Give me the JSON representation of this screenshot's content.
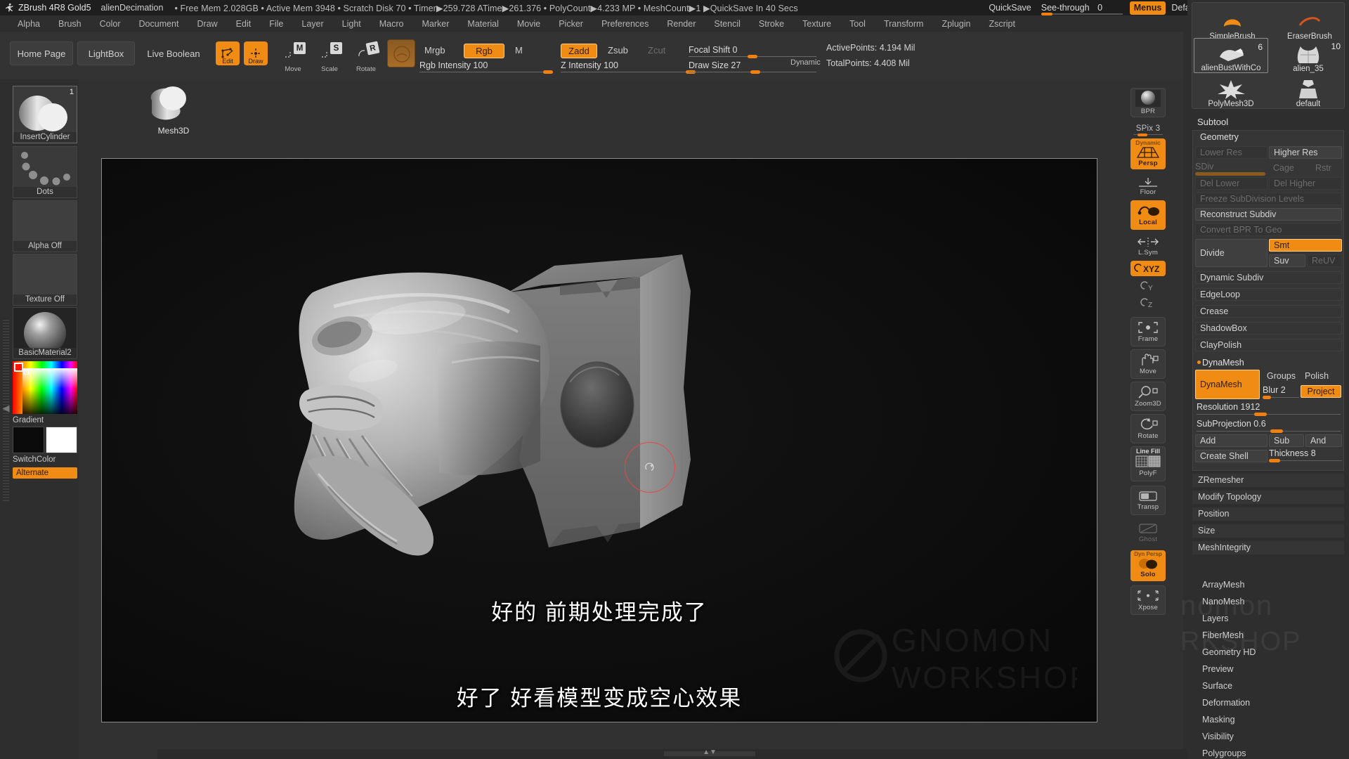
{
  "titlebar": {
    "app": "ZBrush 4R8 Gold5",
    "document": "alienDecimation",
    "stats": "• Free Mem 2.028GB • Active Mem 3948 • Scratch Disk 70 • Timer▶259.728 ATime▶261.376 • PolyCount▶4.233 MP • MeshCount▶1 ▶QuickSave In 40 Secs",
    "quicksave": "QuickSave",
    "seethrough_label": "See-through",
    "seethrough_value": "0",
    "menus": "Menus",
    "default_zscript": "DefaultZScript",
    "dots": "||||"
  },
  "menubar": {
    "items": [
      "Alpha",
      "Brush",
      "Color",
      "Document",
      "Draw",
      "Edit",
      "File",
      "Layer",
      "Light",
      "Macro",
      "Marker",
      "Material",
      "Movie",
      "Picker",
      "Preferences",
      "Render",
      "Stencil",
      "Stroke",
      "Texture",
      "Tool",
      "Transform",
      "Zplugin",
      "Zscript"
    ]
  },
  "shelf": {
    "home_page": "Home Page",
    "lightbox": "LightBox",
    "live_boolean": "Live Boolean",
    "tools": [
      {
        "label": "Edit",
        "state": "on",
        "glyph": ""
      },
      {
        "label": "Draw",
        "state": "on",
        "glyph": ""
      },
      {
        "label": "Move",
        "state": "off",
        "glyph": "M"
      },
      {
        "label": "Scale",
        "state": "off",
        "glyph": "S"
      },
      {
        "label": "Rotate",
        "state": "off",
        "glyph": "R"
      }
    ],
    "color_modes": [
      {
        "label": "Mrgb",
        "state": "off"
      },
      {
        "label": "Rgb",
        "state": "on"
      },
      {
        "label": "M",
        "state": "off"
      }
    ],
    "z_modes": [
      {
        "label": "Zadd",
        "state": "on"
      },
      {
        "label": "Zsub",
        "state": "off"
      },
      {
        "label": "Zcut",
        "state": "dim"
      }
    ],
    "rgb_intensity": {
      "label": "Rgb Intensity 100",
      "fill_pct": 97
    },
    "z_intensity": {
      "label": "Z Intensity 100",
      "fill_pct": 97
    },
    "focal_shift": {
      "label": "Focal Shift 0",
      "fill_pct": 50
    },
    "draw_size": {
      "label": "Draw Size 27",
      "fill_pct": 52
    },
    "dynamic": "Dynamic",
    "active_points": "ActivePoints: 4.194 Mil",
    "total_points": "TotalPoints: 4.408 Mil"
  },
  "left_tray": {
    "brush": {
      "name": "InsertCylinder",
      "badge": "1"
    },
    "mesh3d": {
      "name": "Mesh3D"
    },
    "stroke": {
      "name": "Dots"
    },
    "alpha": {
      "name": "Alpha Off"
    },
    "texture": {
      "name": "Texture Off"
    },
    "material": {
      "name": "BasicMaterial2"
    },
    "gradient": {
      "name": "Gradient"
    },
    "switch_color": {
      "name": "SwitchColor"
    },
    "alternate": {
      "name": "Alternate"
    }
  },
  "canvas": {
    "subtitle_line1": "好的 前期处理完成了",
    "subtitle_line2": "好了 好看模型变成空心效果"
  },
  "right_toolbar": [
    {
      "label": "BPR",
      "state": "off",
      "icon": "sphere-render-icon"
    },
    {
      "label": "SPix 3",
      "state": "slider",
      "icon": "spix-slider"
    },
    {
      "label": "Persp",
      "state": "on",
      "icon": "perspective-icon",
      "sublabel": "Dynamic"
    },
    {
      "label": "Floor",
      "state": "plain",
      "icon": "floor-grid-icon"
    },
    {
      "label": "Local",
      "state": "on",
      "icon": "local-transform-icon"
    },
    {
      "label": "L.Sym",
      "state": "plain",
      "icon": "local-symmetry-icon"
    },
    {
      "label": "XYZ",
      "state": "on",
      "icon": "xyz-axis-icon"
    },
    {
      "label": "Y",
      "state": "plain",
      "icon": "y-rotate-icon"
    },
    {
      "label": "Z",
      "state": "plain",
      "icon": "z-rotate-icon"
    },
    {
      "label": "Frame",
      "state": "off",
      "icon": "frame-icon"
    },
    {
      "label": "Move",
      "state": "off",
      "icon": "hand-move-icon"
    },
    {
      "label": "Zoom3D",
      "state": "off",
      "icon": "magnifier-icon"
    },
    {
      "label": "Rotate",
      "state": "off",
      "icon": "rotate-icon"
    },
    {
      "label": "PolyF",
      "state": "off",
      "icon": "polyframe-icon",
      "sublabel": "Line Fill"
    },
    {
      "label": "Transp",
      "state": "off",
      "icon": "transparency-icon"
    },
    {
      "label": "Ghost",
      "state": "dim",
      "icon": "ghost-icon"
    },
    {
      "label": "Solo",
      "state": "on",
      "icon": "solo-icon",
      "sublabel": "Dyn Persp"
    },
    {
      "label": "Xpose",
      "state": "off",
      "icon": "xpose-icon"
    }
  ],
  "right_panel": {
    "brushes": [
      {
        "name": "SimpleBrush",
        "badge": ""
      },
      {
        "name": "EraserBrush",
        "badge": ""
      },
      {
        "name": "alienBustWithCo",
        "badge": "6",
        "selected": true
      },
      {
        "name": "alien_35",
        "badge": "10"
      },
      {
        "name": "PolyMesh3D",
        "badge": ""
      },
      {
        "name": "default",
        "badge": ""
      }
    ],
    "subtool_title": "Subtool",
    "geometry_title": "Geometry",
    "geometry": {
      "lower_res": "Lower Res",
      "higher_res": "Higher Res",
      "sdiv": "SDiv",
      "cage": "Cage",
      "rstr": "Rstr",
      "del_lower": "Del Lower",
      "del_higher": "Del Higher",
      "freeze_subdiv": "Freeze SubDivision Levels",
      "reconstruct_subdiv": "Reconstruct Subdiv",
      "convert_bpr": "Convert BPR To Geo",
      "divide": "Divide",
      "smt": "Smt",
      "suv": "Suv",
      "reuv": "ReUV"
    },
    "sections": [
      {
        "label": "Dynamic Subdiv"
      },
      {
        "label": "EdgeLoop"
      },
      {
        "label": "Crease"
      },
      {
        "label": "ShadowBox"
      },
      {
        "label": "ClayPolish"
      }
    ],
    "dynamesh": {
      "header": "DynaMesh",
      "button": "DynaMesh",
      "groups": "Groups",
      "polish": "Polish",
      "blur": "Blur 2",
      "project": "Project",
      "resolution": {
        "label": "Resolution 1912",
        "fill_pct": 44
      },
      "subprojection": {
        "label": "SubProjection 0.6",
        "fill_pct": 60
      },
      "add": "Add",
      "sub": "Sub",
      "and": "And",
      "create_shell": "Create Shell",
      "thickness": {
        "label": "Thickness 8",
        "fill_pct": 15
      }
    },
    "sections2": [
      {
        "label": "ZRemesher"
      },
      {
        "label": "Modify Topology"
      },
      {
        "label": "Position"
      },
      {
        "label": "Size"
      },
      {
        "label": "MeshIntegrity"
      }
    ],
    "palettes": [
      "ArrayMesh",
      "NanoMesh",
      "Layers",
      "FiberMesh",
      "Geometry HD",
      "Preview",
      "Surface",
      "Deformation",
      "Masking",
      "Visibility",
      "Polygroups"
    ]
  },
  "colors": {
    "accent": "#f08c14",
    "panel": "#2e2e2e",
    "shelf": "#333333",
    "titlebar": "#1e1e1e",
    "canvas": "#0d0d0d",
    "cursor_ring": "#e34a4a"
  }
}
